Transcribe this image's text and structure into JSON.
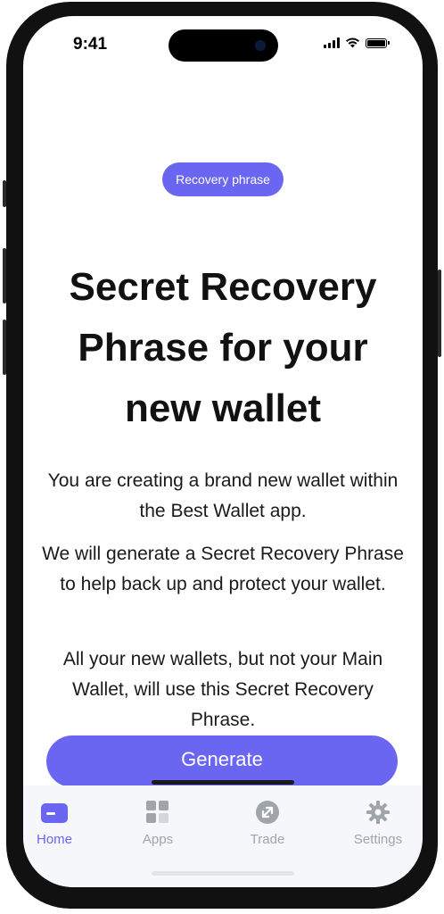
{
  "status_bar": {
    "time": "9:41"
  },
  "badge": "Recovery phrase",
  "title": "Secret Recovery Phrase for your new wallet",
  "paragraphs": [
    "You are creating a brand new wallet within the Best Wallet app.",
    "We will generate a Secret Recovery Phrase to help back up and protect your wallet.",
    "All your new wallets, but not your Main Wallet, will use this Secret Recovery Phrase."
  ],
  "generate_button": "Generate",
  "tabs": [
    {
      "label": "Home",
      "icon": "wallet-icon",
      "active": true
    },
    {
      "label": "Apps",
      "icon": "grid-icon",
      "active": false
    },
    {
      "label": "Trade",
      "icon": "swap-arrow-icon",
      "active": false
    },
    {
      "label": "Settings",
      "icon": "gear-icon",
      "active": false
    }
  ],
  "colors": {
    "accent": "#6b66f2",
    "inactive": "#a0a4ab"
  }
}
